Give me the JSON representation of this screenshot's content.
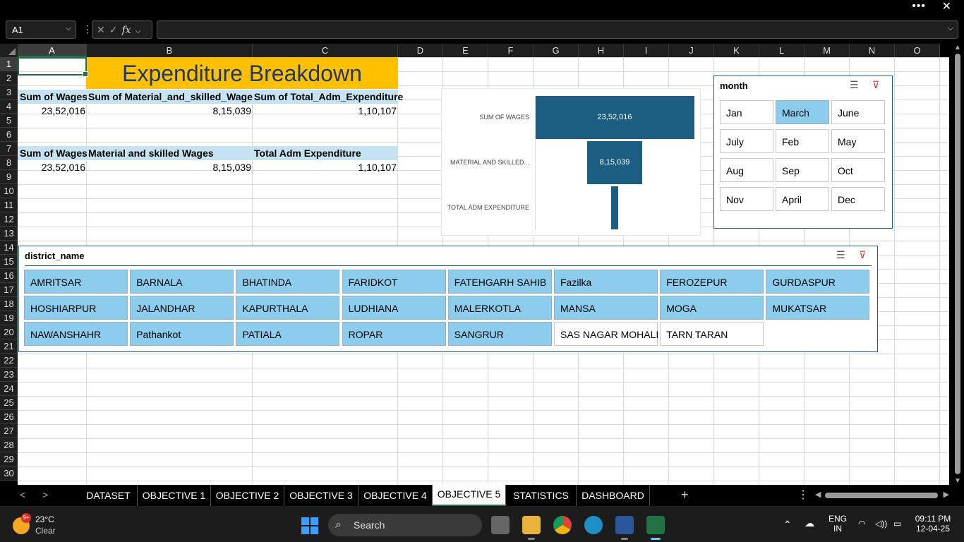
{
  "window": {
    "more_label": "•••",
    "close_label": "✕"
  },
  "formula_bar": {
    "name_box": "A1",
    "formula": "",
    "cancel": "✕",
    "enter": "✓",
    "fx": "fx"
  },
  "columns": [
    "A",
    "B",
    "C",
    "D",
    "E",
    "F",
    "G",
    "H",
    "I",
    "J",
    "K",
    "L",
    "M",
    "N",
    "O"
  ],
  "rows": [
    "1",
    "2",
    "3",
    "4",
    "5",
    "6",
    "7",
    "8",
    "9",
    "10",
    "11",
    "12",
    "13",
    "14",
    "15",
    "16",
    "17",
    "18",
    "19",
    "20",
    "21",
    "22",
    "23",
    "24",
    "25",
    "26",
    "27",
    "28",
    "29",
    "30"
  ],
  "sheet": {
    "title": "Expenditure Breakdown",
    "pivot1": {
      "h1": "Sum of Wages",
      "h2": "Sum of Material_and_skilled_Wages",
      "h3": "Sum of Total_Adm_Expenditure",
      "v1": "23,52,016",
      "v2": "8,15,039",
      "v3": "1,10,107"
    },
    "pivot2": {
      "h1": "Sum of Wages",
      "h2": "Material and skilled Wages",
      "h3": "Total Adm Expenditure",
      "v1": "23,52,016",
      "v2": "8,15,039",
      "v3": "1,10,107"
    }
  },
  "chart_data": {
    "type": "bar",
    "categories": [
      "SUM OF WAGES",
      "MATERIAL AND SKILLED...",
      "TOTAL ADM EXPENDITURE"
    ],
    "values": [
      2352016,
      815039,
      110107
    ],
    "data_labels": [
      "23,52,016",
      "8,15,039",
      ""
    ],
    "color": "#1b5e82"
  },
  "month_slicer": {
    "title": "month",
    "items": [
      {
        "label": "Jan",
        "selected": false
      },
      {
        "label": "March",
        "selected": true
      },
      {
        "label": "June",
        "selected": false
      },
      {
        "label": "July",
        "selected": false
      },
      {
        "label": "Feb",
        "selected": false
      },
      {
        "label": "May",
        "selected": false
      },
      {
        "label": "Aug",
        "selected": false
      },
      {
        "label": "Sep",
        "selected": false
      },
      {
        "label": "Oct",
        "selected": false
      },
      {
        "label": "Nov",
        "selected": false
      },
      {
        "label": "April",
        "selected": false
      },
      {
        "label": "Dec",
        "selected": false
      }
    ]
  },
  "district_slicer": {
    "title": "district_name",
    "items": [
      {
        "label": "AMRITSAR",
        "selected": true
      },
      {
        "label": "BARNALA",
        "selected": true
      },
      {
        "label": "BHATINDA",
        "selected": true
      },
      {
        "label": "FARIDKOT",
        "selected": true
      },
      {
        "label": "FATEHGARH SAHIB",
        "selected": true
      },
      {
        "label": "Fazilka",
        "selected": true
      },
      {
        "label": "FEROZEPUR",
        "selected": true
      },
      {
        "label": "GURDASPUR",
        "selected": true
      },
      {
        "label": "HOSHIARPUR",
        "selected": true
      },
      {
        "label": "JALANDHAR",
        "selected": true
      },
      {
        "label": "KAPURTHALA",
        "selected": true
      },
      {
        "label": "LUDHIANA",
        "selected": true
      },
      {
        "label": "MALERKOTLA",
        "selected": true
      },
      {
        "label": "MANSA",
        "selected": true
      },
      {
        "label": "MOGA",
        "selected": true
      },
      {
        "label": "MUKATSAR",
        "selected": true
      },
      {
        "label": "NAWANSHAHR",
        "selected": true
      },
      {
        "label": "Pathankot",
        "selected": true
      },
      {
        "label": "PATIALA",
        "selected": true
      },
      {
        "label": "ROPAR",
        "selected": true
      },
      {
        "label": "SANGRUR",
        "selected": true
      },
      {
        "label": "SAS NAGAR MOHALI",
        "selected": false
      },
      {
        "label": "TARN TARAN",
        "selected": false
      }
    ]
  },
  "tabs": [
    {
      "label": "DATASET",
      "active": false
    },
    {
      "label": "OBJECTIVE 1",
      "active": false
    },
    {
      "label": "OBJECTIVE 2",
      "active": false
    },
    {
      "label": "OBJECTIVE 3",
      "active": false
    },
    {
      "label": "OBJECTIVE 4",
      "active": false
    },
    {
      "label": "OBJECTIVE 5",
      "active": true
    },
    {
      "label": "STATISTICS",
      "active": false
    },
    {
      "label": "DASHBOARD",
      "active": false
    }
  ],
  "tab_controls": {
    "prev": "<",
    "next": ">",
    "add": "+",
    "more": "⋮"
  },
  "taskbar": {
    "weather": {
      "badge": "9+",
      "temp": "23°C",
      "cond": "Clear"
    },
    "search_placeholder": "Search",
    "lang1": "ENG",
    "lang2": "IN",
    "time": "09:11 PM",
    "date": "12-04-25"
  }
}
